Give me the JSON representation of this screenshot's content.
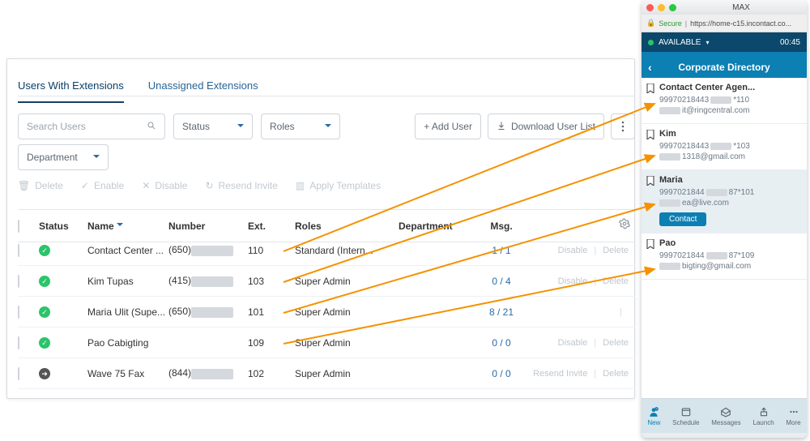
{
  "tabs": [
    "Users With Extensions",
    "Unassigned Extensions"
  ],
  "search": {
    "placeholder": "Search Users"
  },
  "filters": {
    "status": "Status",
    "roles": "Roles",
    "department": "Department"
  },
  "actions": {
    "add": "+ Add User",
    "download": "Download User List"
  },
  "disabled_toolbar": {
    "delete": "Delete",
    "enable": "Enable",
    "disable": "Disable",
    "resend": "Resend Invite",
    "templates": "Apply Templates"
  },
  "columns": {
    "status": "Status",
    "name": "Name",
    "number": "Number",
    "ext": "Ext.",
    "roles": "Roles",
    "dept": "Department",
    "msg": "Msg."
  },
  "rows": [
    {
      "status": "on",
      "name": "Contact Center ...",
      "number_prefix": "(650)",
      "ext": "110",
      "role": "Standard (Intern...",
      "msg": "1 / 1",
      "actions": [
        "Disable",
        "Delete"
      ]
    },
    {
      "status": "on",
      "name": "Kim Tupas",
      "number_prefix": "(415)",
      "ext": "103",
      "role": "Super Admin",
      "msg": "0 / 4",
      "actions": [
        "Disable",
        "Delete"
      ]
    },
    {
      "status": "on",
      "name": "Maria Ulit (Supe...",
      "number_prefix": "(650)",
      "ext": "101",
      "role": "Super Admin",
      "msg": "8 / 21",
      "actions": [
        "",
        ""
      ]
    },
    {
      "status": "on",
      "name": "Pao Cabigting",
      "number_prefix": "",
      "ext": "109",
      "role": "Super Admin",
      "msg": "0 / 0",
      "actions": [
        "Disable",
        "Delete"
      ]
    },
    {
      "status": "off",
      "name": "Wave 75 Fax",
      "number_prefix": "(844)",
      "ext": "102",
      "role": "Super Admin",
      "msg": "0 / 0",
      "actions": [
        "Resend Invite",
        "Delete"
      ]
    }
  ],
  "phone": {
    "window_title": "MAX",
    "url_secure": "Secure",
    "url": "https://home-c15.incontact.co...",
    "agent_state": "AVAILABLE",
    "agent_time": "00:45",
    "dir_title": "Corporate Directory",
    "contacts": [
      {
        "name": "Contact Center Agen...",
        "num_a": "99970218443",
        "num_b": "*110",
        "email_a": "",
        "email_b": "it@ringcentral.com"
      },
      {
        "name": "Kim",
        "num_a": "99970218443",
        "num_b": "*103",
        "email_a": "",
        "email_b": "1318@gmail.com"
      },
      {
        "name": "Maria",
        "num_a": "9997021844",
        "num_b": "87*101",
        "email_a": "",
        "email_b": "ea@live.com",
        "selected": true,
        "contact_btn": "Contact"
      },
      {
        "name": "Pao",
        "num_a": "9997021844",
        "num_b": "87*109",
        "email_a": "",
        "email_b": "bigting@gmail.com"
      }
    ],
    "bottom_nav": [
      "New",
      "Schedule",
      "Messages",
      "Launch",
      "More"
    ]
  }
}
